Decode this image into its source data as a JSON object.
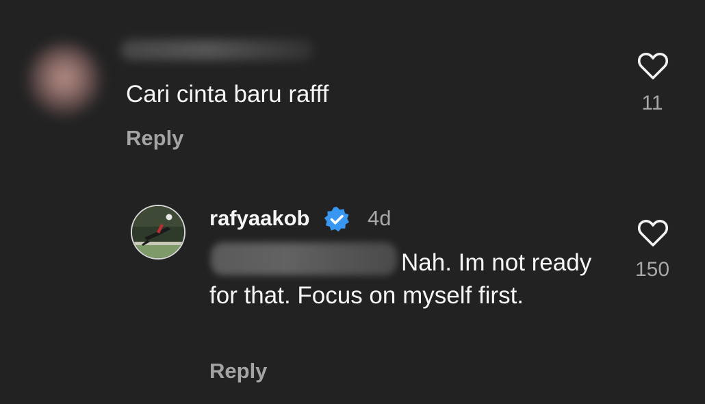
{
  "comments": [
    {
      "text": "Cari cinta baru rafff",
      "reply_label": "Reply",
      "like_count": "11",
      "username_blurred": true,
      "avatar_blurred": true
    },
    {
      "username": "rafyaakob",
      "verified": true,
      "timestamp": "4d",
      "text": "Nah. Im not ready for that. Focus on myself first.",
      "mention_blurred": true,
      "reply_label": "Reply",
      "like_count": "150"
    }
  ],
  "colors": {
    "background": "#222222",
    "text_primary": "#f6f6f6",
    "text_secondary": "#a8a8a8",
    "verified_badge": "#3897f0"
  },
  "icons": [
    "heart-outline-icon",
    "verified-badge-icon"
  ]
}
